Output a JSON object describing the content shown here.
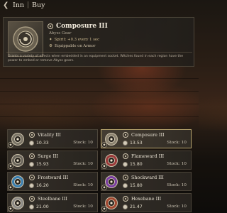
{
  "header": {
    "back_label": "❮",
    "title": "Inn",
    "separator": "|",
    "subtitle": "Buy"
  },
  "detail": {
    "name": "Composure III",
    "type": "Abyss Gear",
    "stat": "Spirit: +0.3 every 1 sec",
    "equip": "Equippable on Armor",
    "description": "Grants a variety of effects when embedded in an equipment socket. Witches found in each region have the power to embed or remove Abyss gears."
  },
  "items": [
    {
      "name": "Vitality III",
      "price": "10.33",
      "stock": "Stock: 10",
      "icon": "vitality-gear-icon",
      "color": "#7a7466",
      "selected": false
    },
    {
      "name": "Composure III",
      "price": "13.53",
      "stock": "Stock: 10",
      "icon": "composure-gear-icon",
      "color": "#8b8270",
      "selected": true
    },
    {
      "name": "Surge III",
      "price": "15.93",
      "stock": "Stock: 10",
      "icon": "surge-gear-icon",
      "color": "#6b665c",
      "selected": false
    },
    {
      "name": "Flameward III",
      "price": "15.80",
      "stock": "Stock: 10",
      "icon": "flameward-gear-icon",
      "color": "#9a3a3a",
      "selected": false
    },
    {
      "name": "Frostward III",
      "price": "16.20",
      "stock": "Stock: 10",
      "icon": "frostward-gear-icon",
      "color": "#3a7fb0",
      "selected": false
    },
    {
      "name": "Shockward III",
      "price": "15.80",
      "stock": "Stock: 10",
      "icon": "shockward-gear-icon",
      "color": "#7a3fa0",
      "selected": false
    },
    {
      "name": "Steelbane III",
      "price": "21.00",
      "stock": "Stock: 10",
      "icon": "steelbane-gear-icon",
      "color": "#8c8a86",
      "selected": false
    },
    {
      "name": "Hexebane III",
      "price": "21.47",
      "stock": "Stock: 10",
      "icon": "hexebane-gear-icon",
      "color": "#a04830",
      "selected": false
    }
  ]
}
